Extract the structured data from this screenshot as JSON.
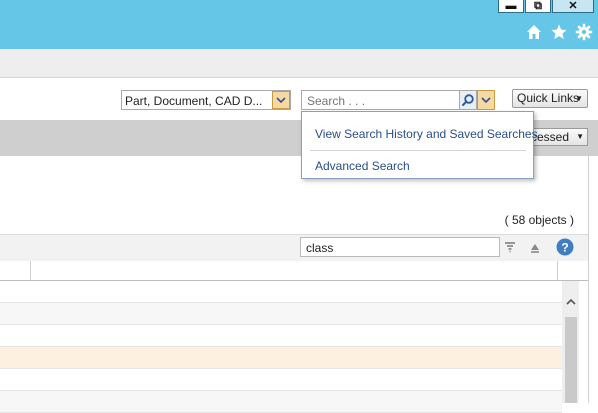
{
  "window_controls": {
    "minimize": "▬",
    "restore": "⧉",
    "close": "✕"
  },
  "header_icons": [
    "home-icon",
    "star-icon",
    "gear-icon"
  ],
  "search_context": {
    "selected": "Part, Document, CAD D..."
  },
  "search": {
    "placeholder": "Search . . ."
  },
  "quick_links": {
    "label": "Quick Links"
  },
  "search_menu": {
    "items": [
      "View Search History and Saved Searches",
      "Advanced Search"
    ]
  },
  "recently_accessed": {
    "label": "ccessed"
  },
  "table": {
    "object_count": "( 58 objects )",
    "filter_value": "class",
    "highlight_color": "#fdf0e0"
  }
}
